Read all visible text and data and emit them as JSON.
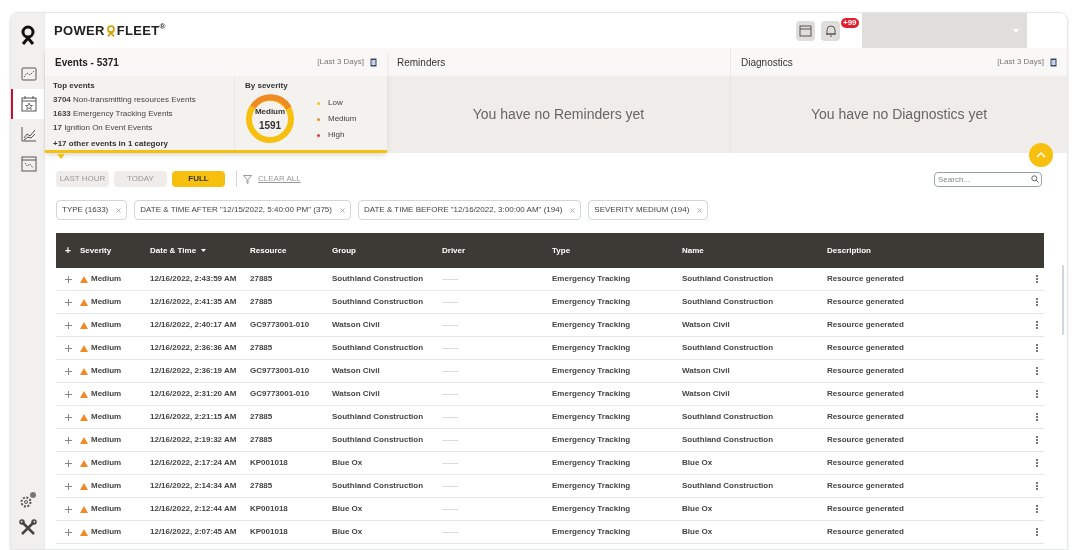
{
  "header": {
    "brand": "POWER",
    "brand_tail": "FLEET",
    "brand_mark": "®",
    "notification_count": "+99"
  },
  "sidebar": {
    "items": [
      {
        "kind": "map",
        "selected": false
      },
      {
        "kind": "calendar",
        "selected": true
      },
      {
        "kind": "chart",
        "selected": false
      },
      {
        "kind": "board",
        "selected": false
      }
    ]
  },
  "panels": {
    "events": {
      "title": "Events - 5371",
      "range": "[Last 3 Days]",
      "top_events_title": "Top events",
      "top_events": [
        {
          "count": "3704",
          "label": "Non-transmitting resources Events"
        },
        {
          "count": "1633",
          "label": "Emergency Tracking Events"
        },
        {
          "count": "17",
          "label": "Ignition On Event Events"
        }
      ],
      "other": "+17 other events in 1 category",
      "severity_title": "By severity",
      "donut_label": "Medium",
      "donut_value": "1591",
      "legend": [
        {
          "label": "Low",
          "color": "#f5c518"
        },
        {
          "label": "Medium",
          "color": "#f08a24"
        },
        {
          "label": "High",
          "color": "#e8364f"
        }
      ]
    },
    "reminders": {
      "title": "Reminders",
      "empty": "You have no Reminders yet"
    },
    "diagnostics": {
      "title": "Diagnostics",
      "range": "[Last 3 Days]",
      "empty": "You have no Diagnostics yet"
    }
  },
  "time_filters": [
    {
      "label": "LAST HOUR",
      "selected": false
    },
    {
      "label": "TODAY",
      "selected": false
    },
    {
      "label": "FULL",
      "selected": true
    }
  ],
  "clear_all": "CLEAR ALL",
  "search": {
    "placeholder": "Search..."
  },
  "filter_chips": [
    "TYPE (1633)",
    "DATE & TIME AFTER \"12/15/2022, 5:40:00 PM\" (375)",
    "DATE & TIME BEFORE \"12/16/2022, 3:00:00 AM\" (194)",
    "SEVERITY MEDIUM (194)"
  ],
  "table": {
    "expand_all": "+",
    "columns": [
      "Severity",
      "Date & Time",
      "Resource",
      "Group",
      "Driver",
      "Type",
      "Name",
      "Description"
    ],
    "rows": [
      [
        "Medium",
        "12/16/2022, 2:43:59 AM",
        "27885",
        "Southland Construction",
        "——",
        "Emergency Tracking",
        "Southland Construction",
        "Resource generated"
      ],
      [
        "Medium",
        "12/16/2022, 2:41:35 AM",
        "27885",
        "Southland Construction",
        "——",
        "Emergency Tracking",
        "Southland Construction",
        "Resource generated"
      ],
      [
        "Medium",
        "12/16/2022, 2:40:17 AM",
        "GC9773001-010",
        "Watson Civil",
        "——",
        "Emergency Tracking",
        "Watson Civil",
        "Resource generated"
      ],
      [
        "Medium",
        "12/16/2022, 2:36:36 AM",
        "27885",
        "Southland Construction",
        "——",
        "Emergency Tracking",
        "Southland Construction",
        "Resource generated"
      ],
      [
        "Medium",
        "12/16/2022, 2:36:19 AM",
        "GC9773001-010",
        "Watson Civil",
        "——",
        "Emergency Tracking",
        "Watson Civil",
        "Resource generated"
      ],
      [
        "Medium",
        "12/16/2022, 2:31:20 AM",
        "GC9773001-010",
        "Watson Civil",
        "——",
        "Emergency Tracking",
        "Watson Civil",
        "Resource generated"
      ],
      [
        "Medium",
        "12/16/2022, 2:21:15 AM",
        "27885",
        "Southland Construction",
        "——",
        "Emergency Tracking",
        "Southland Construction",
        "Resource generated"
      ],
      [
        "Medium",
        "12/16/2022, 2:19:32 AM",
        "27885",
        "Southland Construction",
        "——",
        "Emergency Tracking",
        "Southland Construction",
        "Resource generated"
      ],
      [
        "Medium",
        "12/16/2022, 2:17:24 AM",
        "KP001018",
        "Blue Ox",
        "——",
        "Emergency Tracking",
        "Blue Ox",
        "Resource generated"
      ],
      [
        "Medium",
        "12/16/2022, 2:14:34 AM",
        "27885",
        "Southland Construction",
        "——",
        "Emergency Tracking",
        "Southland Construction",
        "Resource generated"
      ],
      [
        "Medium",
        "12/16/2022, 2:12:44 AM",
        "KP001018",
        "Blue Ox",
        "——",
        "Emergency Tracking",
        "Blue Ox",
        "Resource generated"
      ],
      [
        "Medium",
        "12/16/2022, 2:07:45 AM",
        "KP001018",
        "Blue Ox",
        "——",
        "Emergency Tracking",
        "Blue Ox",
        "Resource generated"
      ]
    ]
  }
}
